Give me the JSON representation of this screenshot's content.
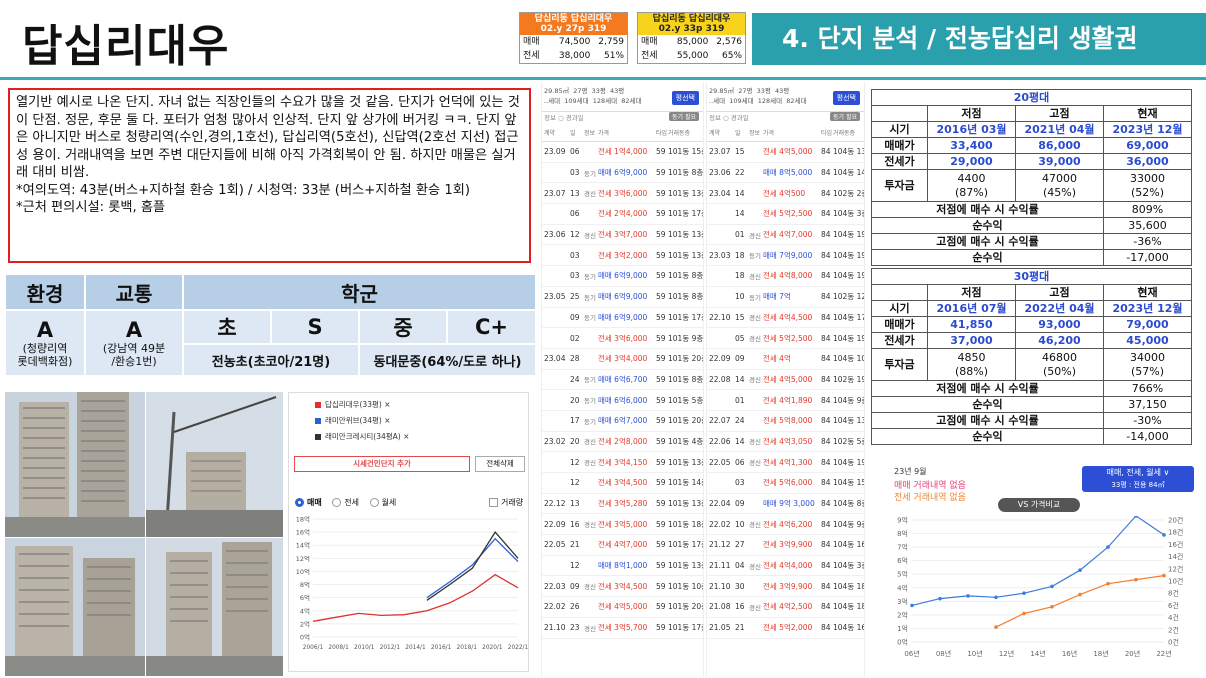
{
  "header": {
    "title": "답십리대우",
    "section_title": "4. 단지 분석 / 전농답십리 생활권",
    "mini_left": {
      "title": "답십리동 답십리대우",
      "subtitle": "02.y 27p 319",
      "rows": [
        {
          "label": "매매",
          "value": "74,500",
          "extra": "2,759"
        },
        {
          "label": "전세",
          "value": "38,000",
          "extra": "51%"
        }
      ]
    },
    "mini_right": {
      "title": "답십리동 답십리대우",
      "subtitle": "02.y 33p 319",
      "rows": [
        {
          "label": "매매",
          "value": "85,000",
          "extra": "2,576"
        },
        {
          "label": "전세",
          "value": "55,000",
          "extra": "65%"
        }
      ]
    }
  },
  "description": {
    "body": "열기반 예시로 나온 단지. 자녀 없는 직장인들의 수요가 많을 것 같음. 단지가 언덕에 있는 것이 단점. 정문, 후문 둘 다. 포터가 엄청 많아서 인상적. 단지 앞 상가에 버거킹 ㅋㅋ. 단지 앞은 아니지만 버스로 청량리역(수인,경의,1호선), 답십리역(5호선), 신답역(2호선 지선) 접근성 용이. 거래내역을 보면 주변 대단지들에 비해 아직 가격회복이 안 됨. 하지만 매물은 실거래 대비 비쌈.",
    "line2": "*여의도역: 43분(버스+지하철 환승 1회) / 시청역: 33분 (버스+지하철 환승 1회)",
    "line3": "*근처 편의시설: 롯백, 홈플"
  },
  "grades": {
    "env_h": "환경",
    "traffic_h": "교통",
    "school_h": "학군",
    "env_g": "A",
    "env_note": "(청량리역\n롯데백화점)",
    "traffic_g": "A",
    "traffic_note": "(강남역 49분\n/환승1번)",
    "elem_g": "초",
    "s_g": "S",
    "mid_g": "중",
    "cplus_g": "C+",
    "elem_note": "전농초(초코아/21명)",
    "mid_note": "동대문중(64%/도로 하나)"
  },
  "chart_left": {
    "legend": [
      "답십리대우(33평)",
      "래미안위브(34평)",
      "래미안크레시티(34평A)"
    ],
    "legend_colors": [
      "#e03030",
      "#2d5fd6",
      "#333333"
    ],
    "add_btn": "시세건인단지 추가",
    "del_btn": "전체삭제",
    "radio": [
      "매매",
      "전세",
      "월세"
    ],
    "check": "거래량"
  },
  "chart_data": [
    {
      "type": "line",
      "title": "",
      "x": [
        "2006/1",
        "2008/1",
        "2010/1",
        "2012/1",
        "2014/1",
        "2016/1",
        "2018/1",
        "2020/1",
        "2022/1"
      ],
      "ylim": [
        0,
        18
      ],
      "yticks": [
        "18억",
        "16억",
        "14억",
        "12억",
        "10억",
        "8억",
        "6억",
        "4억",
        "2억",
        "0억"
      ],
      "series": [
        {
          "name": "답십리대우(33평)",
          "color": "#e03030",
          "values": [
            2.4,
            3.0,
            3.6,
            3.3,
            3.4,
            4.0,
            5.2,
            7.0,
            9.5,
            7.5
          ]
        },
        {
          "name": "래미안위브(34평)",
          "color": "#2d5fd6",
          "values": [
            null,
            null,
            null,
            null,
            null,
            6.0,
            8.4,
            11.0,
            15.0,
            11.5
          ]
        },
        {
          "name": "래미안크레시티(34평A)",
          "color": "#333333",
          "values": [
            null,
            null,
            null,
            null,
            null,
            5.6,
            8.0,
            10.5,
            16.0,
            12.0
          ]
        }
      ]
    },
    {
      "type": "line",
      "title": "VS 가격비교",
      "xlabels": [
        "06년",
        "08년",
        "10년",
        "12년",
        "14년",
        "16년",
        "18년",
        "20년",
        "22년"
      ],
      "yleft": [
        "9억",
        "8억",
        "7억",
        "6억",
        "5억",
        "4억",
        "3억",
        "2억",
        "1억",
        "0억"
      ],
      "yright": [
        "20건",
        "18건",
        "16건",
        "14건",
        "12건",
        "10건",
        "8건",
        "6건",
        "4건",
        "2건",
        "0건"
      ],
      "series": [
        {
          "name": "매매",
          "color": "#3b7dd8",
          "values": [
            2.7,
            3.2,
            3.4,
            3.3,
            3.6,
            4.1,
            5.3,
            7.0,
            9.3,
            7.9
          ]
        },
        {
          "name": "전세",
          "color": "#f08030",
          "values": [
            null,
            null,
            null,
            1.1,
            2.1,
            2.6,
            3.5,
            4.3,
            4.6,
            4.9
          ]
        }
      ],
      "note1": "23년 9월",
      "note2": "매매 거래내역 없음",
      "note3": "전세 거래내역 없음",
      "badge": "매매, 전세, 월세 ∨",
      "badge2": "33평 : 전용 84㎡"
    }
  ],
  "txn_left": {
    "summary": "29.85㎡  27평  33평  43평\n..세대  109세대  128세대  82세대",
    "btn": "평선택",
    "sub": "정보 ○ 경과일",
    "sub_btn": "동기 필요",
    "rows": [
      {
        "d": "23.09",
        "dd": "06",
        "k": "",
        "p": "전세 1억4,000",
        "a": "59",
        "f": "101동 15층",
        "b": false
      },
      {
        "d": "",
        "dd": "03",
        "k": "동기",
        "p": "매매 6억9,000",
        "a": "59",
        "f": "101동 8층",
        "b": true
      },
      {
        "d": "23.07",
        "dd": "13",
        "k": "경신",
        "p": "전세 3억6,000",
        "a": "59",
        "f": "101동 13층",
        "b": false
      },
      {
        "d": "",
        "dd": "06",
        "k": "",
        "p": "전세 2억4,000",
        "a": "59",
        "f": "101동 17층",
        "b": false
      },
      {
        "d": "23.06",
        "dd": "12",
        "k": "경신",
        "p": "전세 3억7,000",
        "a": "59",
        "f": "101동 13층",
        "b": false
      },
      {
        "d": "",
        "dd": "03",
        "k": "",
        "p": "전세 3억2,000",
        "a": "59",
        "f": "101동 13층",
        "b": false
      },
      {
        "d": "",
        "dd": "03",
        "k": "동기",
        "p": "매매 6억9,000",
        "a": "59",
        "f": "101동 8층",
        "b": true
      },
      {
        "d": "23.05",
        "dd": "25",
        "k": "동기",
        "p": "매매 6억9,000",
        "a": "59",
        "f": "101동 8층",
        "b": true
      },
      {
        "d": "",
        "dd": "09",
        "k": "동기",
        "p": "매매 6억9,000",
        "a": "59",
        "f": "101동 17층",
        "b": true
      },
      {
        "d": "",
        "dd": "02",
        "k": "",
        "p": "전세 3억6,000",
        "a": "59",
        "f": "101동 9층",
        "b": false
      },
      {
        "d": "23.04",
        "dd": "28",
        "k": "",
        "p": "전세 3억4,000",
        "a": "59",
        "f": "101동 20층",
        "b": false
      },
      {
        "d": "",
        "dd": "24",
        "k": "동기",
        "p": "매매 6억6,700",
        "a": "59",
        "f": "101동 8층",
        "b": true
      },
      {
        "d": "",
        "dd": "20",
        "k": "동기",
        "p": "매매 6억6,000",
        "a": "59",
        "f": "101동 5층",
        "b": true
      },
      {
        "d": "",
        "dd": "17",
        "k": "동기",
        "p": "매매 6억7,000",
        "a": "59",
        "f": "101동 20층",
        "b": true
      },
      {
        "d": "23.02",
        "dd": "20",
        "k": "경신",
        "p": "전세 2억8,000",
        "a": "59",
        "f": "101동 4층",
        "b": false
      },
      {
        "d": "",
        "dd": "12",
        "k": "경신",
        "p": "전세 3억4,150",
        "a": "59",
        "f": "101동 13층",
        "b": false
      },
      {
        "d": "",
        "dd": "12",
        "k": "",
        "p": "전세 3억4,500",
        "a": "59",
        "f": "101동 14층",
        "b": false
      },
      {
        "d": "22.12",
        "dd": "13",
        "k": "",
        "p": "전세 3억5,280",
        "a": "59",
        "f": "101동 13층",
        "b": false
      },
      {
        "d": "22.09",
        "dd": "16",
        "k": "경신",
        "p": "전세 3억5,000",
        "a": "59",
        "f": "101동 18층",
        "b": false
      },
      {
        "d": "22.05",
        "dd": "21",
        "k": "",
        "p": "전세 4억7,000",
        "a": "59",
        "f": "101동 17층",
        "b": false
      },
      {
        "d": "",
        "dd": "12",
        "k": "",
        "p": "매매 8억1,000",
        "a": "59",
        "f": "101동 13층",
        "b": true
      },
      {
        "d": "22.03",
        "dd": "09",
        "k": "경신",
        "p": "전세 3억4,500",
        "a": "59",
        "f": "101동 10층",
        "b": false
      },
      {
        "d": "22.02",
        "dd": "26",
        "k": "",
        "p": "전세 4억5,000",
        "a": "59",
        "f": "101동 20층",
        "b": false
      },
      {
        "d": "21.10",
        "dd": "23",
        "k": "경신",
        "p": "전세 3억5,700",
        "a": "59",
        "f": "101동 17층",
        "b": false
      }
    ]
  },
  "txn_right": {
    "summary": "29.85㎡  27평  33평  43평\n..세대  109세대  128세대  82세대",
    "btn": "평선택",
    "sub": "정보 ○ 경과일",
    "sub_btn": "동기 필요",
    "rows": [
      {
        "d": "23.07",
        "dd": "15",
        "k": "",
        "p": "전세 4억5,000",
        "a": "84",
        "f": "104동 13층",
        "b": false
      },
      {
        "d": "23.06",
        "dd": "22",
        "k": "",
        "p": "매매 8억5,000",
        "a": "84",
        "f": "104동 14층",
        "b": true
      },
      {
        "d": "23.04",
        "dd": "14",
        "k": "",
        "p": "전세 4억500",
        "a": "84",
        "f": "102동 2층",
        "b": false
      },
      {
        "d": "",
        "dd": "14",
        "k": "",
        "p": "전세 5억2,500",
        "a": "84",
        "f": "104동 3층",
        "b": false
      },
      {
        "d": "",
        "dd": "01",
        "k": "경신",
        "p": "전세 4억7,000",
        "a": "84",
        "f": "104동 19층",
        "b": false
      },
      {
        "d": "23.03",
        "dd": "18",
        "k": "동기",
        "p": "매매 7억9,000",
        "a": "84",
        "f": "104동 19층",
        "b": true
      },
      {
        "d": "",
        "dd": "18",
        "k": "경신",
        "p": "전세 4억8,000",
        "a": "84",
        "f": "104동 19층",
        "b": false
      },
      {
        "d": "",
        "dd": "10",
        "k": "동기",
        "p": "매매 7억",
        "a": "84",
        "f": "102동 12층",
        "b": true
      },
      {
        "d": "22.10",
        "dd": "15",
        "k": "경신",
        "p": "전세 4억4,500",
        "a": "84",
        "f": "104동 17층",
        "b": false
      },
      {
        "d": "",
        "dd": "05",
        "k": "경신",
        "p": "전세 5억2,500",
        "a": "84",
        "f": "104동 19층",
        "b": false
      },
      {
        "d": "22.09",
        "dd": "09",
        "k": "",
        "p": "전세 4억",
        "a": "84",
        "f": "104동 10층",
        "b": false
      },
      {
        "d": "22.08",
        "dd": "14",
        "k": "경신",
        "p": "전세 4억5,000",
        "a": "84",
        "f": "102동 19층",
        "b": false
      },
      {
        "d": "",
        "dd": "01",
        "k": "",
        "p": "전세 4억1,890",
        "a": "84",
        "f": "104동 9층",
        "b": false
      },
      {
        "d": "22.07",
        "dd": "24",
        "k": "",
        "p": "전세 5억8,000",
        "a": "84",
        "f": "104동 13층",
        "b": false
      },
      {
        "d": "22.06",
        "dd": "14",
        "k": "경신",
        "p": "전세 4억3,050",
        "a": "84",
        "f": "102동 5층",
        "b": false
      },
      {
        "d": "22.05",
        "dd": "06",
        "k": "경신",
        "p": "전세 4억1,300",
        "a": "84",
        "f": "104동 19층",
        "b": false
      },
      {
        "d": "",
        "dd": "03",
        "k": "",
        "p": "전세 5억6,000",
        "a": "84",
        "f": "104동 15층",
        "b": false
      },
      {
        "d": "22.04",
        "dd": "09",
        "k": "",
        "p": "매매 9억 3,000",
        "a": "84",
        "f": "104동 8층",
        "b": true
      },
      {
        "d": "22.02",
        "dd": "10",
        "k": "경신",
        "p": "전세 4억6,200",
        "a": "84",
        "f": "104동 9층",
        "b": false
      },
      {
        "d": "21.12",
        "dd": "27",
        "k": "",
        "p": "전세 3억9,900",
        "a": "84",
        "f": "104동 16층",
        "b": false
      },
      {
        "d": "21.11",
        "dd": "04",
        "k": "경신",
        "p": "전세 4억4,000",
        "a": "84",
        "f": "104동 3층",
        "b": false
      },
      {
        "d": "21.10",
        "dd": "30",
        "k": "",
        "p": "전세 3억9,900",
        "a": "84",
        "f": "104동 18층",
        "b": false
      },
      {
        "d": "21.08",
        "dd": "16",
        "k": "경신",
        "p": "전세 4억2,500",
        "a": "84",
        "f": "104동 18층",
        "b": false
      },
      {
        "d": "21.05",
        "dd": "21",
        "k": "",
        "p": "전세 5억2,000",
        "a": "84",
        "f": "104동 16층",
        "b": false
      }
    ]
  },
  "table20": {
    "caption": "20평대",
    "cols": [
      "저점",
      "고점",
      "현재"
    ],
    "rows": [
      {
        "label": "시기",
        "v": [
          "2016년 03월",
          "2021년 04월",
          "2023년 12월"
        ]
      },
      {
        "label": "매매가",
        "v": [
          "33,400",
          "86,000",
          "69,000"
        ]
      },
      {
        "label": "전세가",
        "v": [
          "29,000",
          "39,000",
          "36,000"
        ]
      }
    ],
    "invest_label": "투자금",
    "invest": [
      [
        "4400",
        "(87%)"
      ],
      [
        "47000",
        "(45%)"
      ],
      [
        "33000",
        "(52%)"
      ]
    ],
    "summary": [
      {
        "label": "저점에 매수 시 수익률",
        "value": "809%"
      },
      {
        "label": "순수익",
        "value": "35,600"
      },
      {
        "label": "고점에 매수 시 수익률",
        "value": "-36%"
      },
      {
        "label": "순수익",
        "value": "-17,000"
      }
    ]
  },
  "table30": {
    "caption": "30평대",
    "cols": [
      "저점",
      "고점",
      "현재"
    ],
    "rows": [
      {
        "label": "시기",
        "v": [
          "2016년 07월",
          "2022년 04월",
          "2023년 12월"
        ]
      },
      {
        "label": "매매가",
        "v": [
          "41,850",
          "93,000",
          "79,000"
        ]
      },
      {
        "label": "전세가",
        "v": [
          "37,000",
          "46,200",
          "45,000"
        ]
      }
    ],
    "invest_label": "투자금",
    "invest": [
      [
        "4850",
        "(88%)"
      ],
      [
        "46800",
        "(50%)"
      ],
      [
        "34000",
        "(57%)"
      ]
    ],
    "summary": [
      {
        "label": "저점에 매수 시 수익률",
        "value": "766%"
      },
      {
        "label": "순수익",
        "value": "37,150"
      },
      {
        "label": "고점에 매수 시 수익률",
        "value": "-30%"
      },
      {
        "label": "순수익",
        "value": "-14,000"
      }
    ]
  },
  "colors": {
    "accent": "#2aa0ad",
    "red": "#e03030",
    "blue": "#2d5fd6",
    "grade_head": "#b7cfe6",
    "grade_cell": "#dde8f4"
  }
}
